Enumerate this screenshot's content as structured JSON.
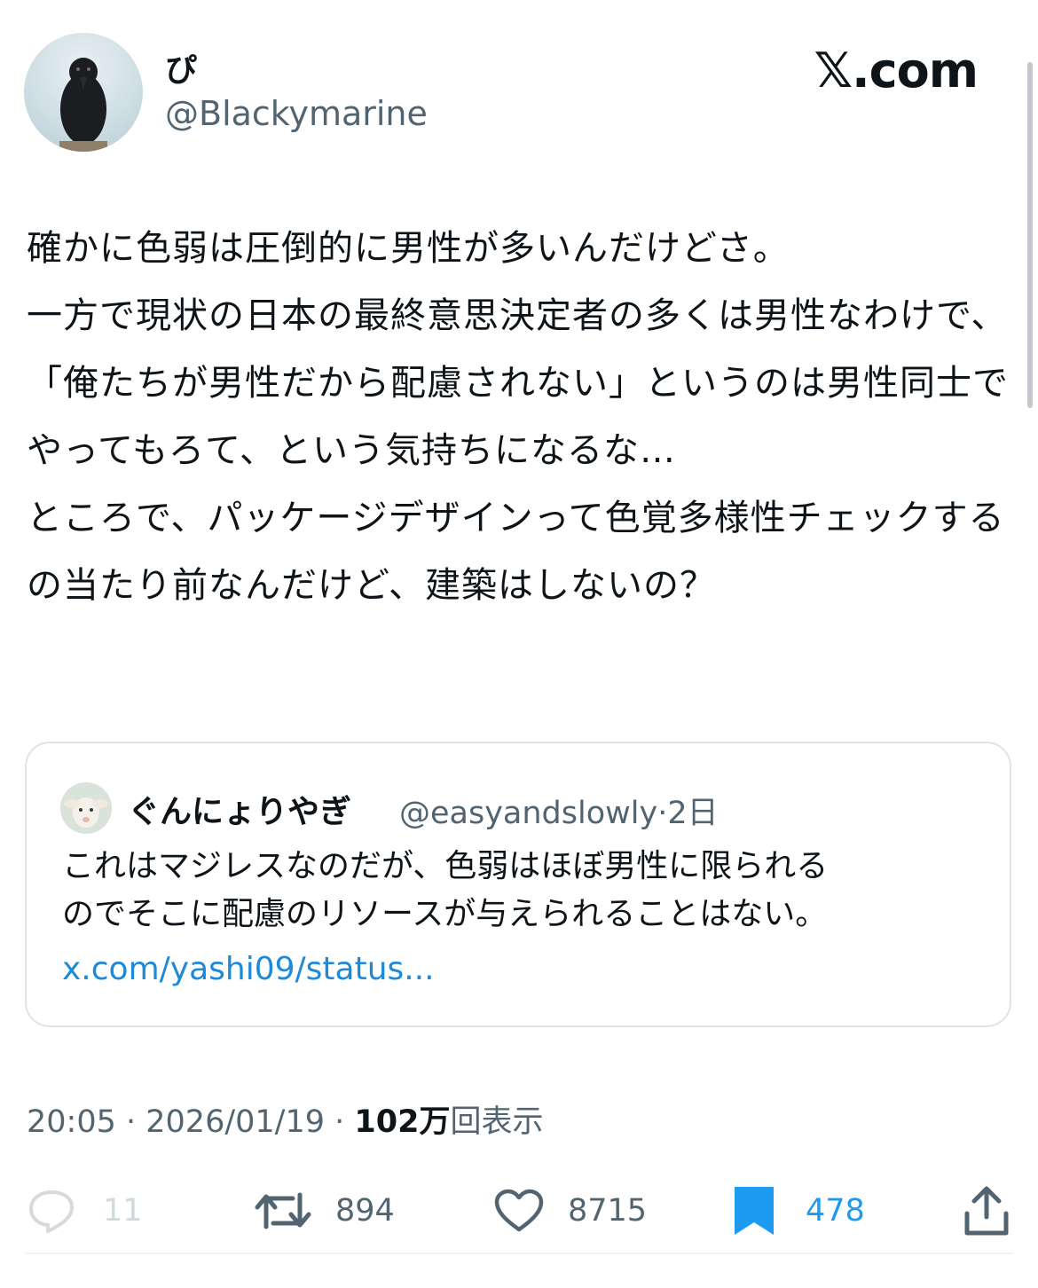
{
  "brand": "𝕏.com",
  "author": {
    "display_name": "ぴ",
    "handle": "@Blackymarine"
  },
  "post": {
    "paragraphs": [
      "確かに色弱は圧倒的に男性が多いんだけどさ。",
      "一方で現状の日本の最終意思決定者の多くは男性なわけで、「俺たちが男性だから配慮されない」というのは男性同士でやってもろて、という気持ちになるな…",
      "ところで、パッケージデザインって色覚多様性チェックするの当たり前なんだけど、建築はしないの？"
    ]
  },
  "quoted": {
    "display_name": "ぐんにょりやぎ",
    "handle": "@easyandslowly",
    "separator": "·",
    "age": "2日",
    "lines": [
      "これはマジレスなのだが、色弱はほぼ男性に限られる",
      "のでそこに配慮のリソースが与えられることはない。"
    ],
    "link": "x.com/yashi09/status..."
  },
  "meta": {
    "time": "20:05",
    "sep1": " · ",
    "date": "2026/01/19",
    "sep2": " · ",
    "views": "102万",
    "views_label": "回表示"
  },
  "actions": {
    "reply": {
      "icon": "reply-icon",
      "count": "11"
    },
    "repost": {
      "icon": "repost-icon",
      "count": "894"
    },
    "like": {
      "icon": "heart-icon",
      "count": "8715"
    },
    "bookmark": {
      "icon": "bookmark-icon",
      "count": "478",
      "color": "#1d9bf0"
    },
    "share": {
      "icon": "share-icon"
    }
  }
}
